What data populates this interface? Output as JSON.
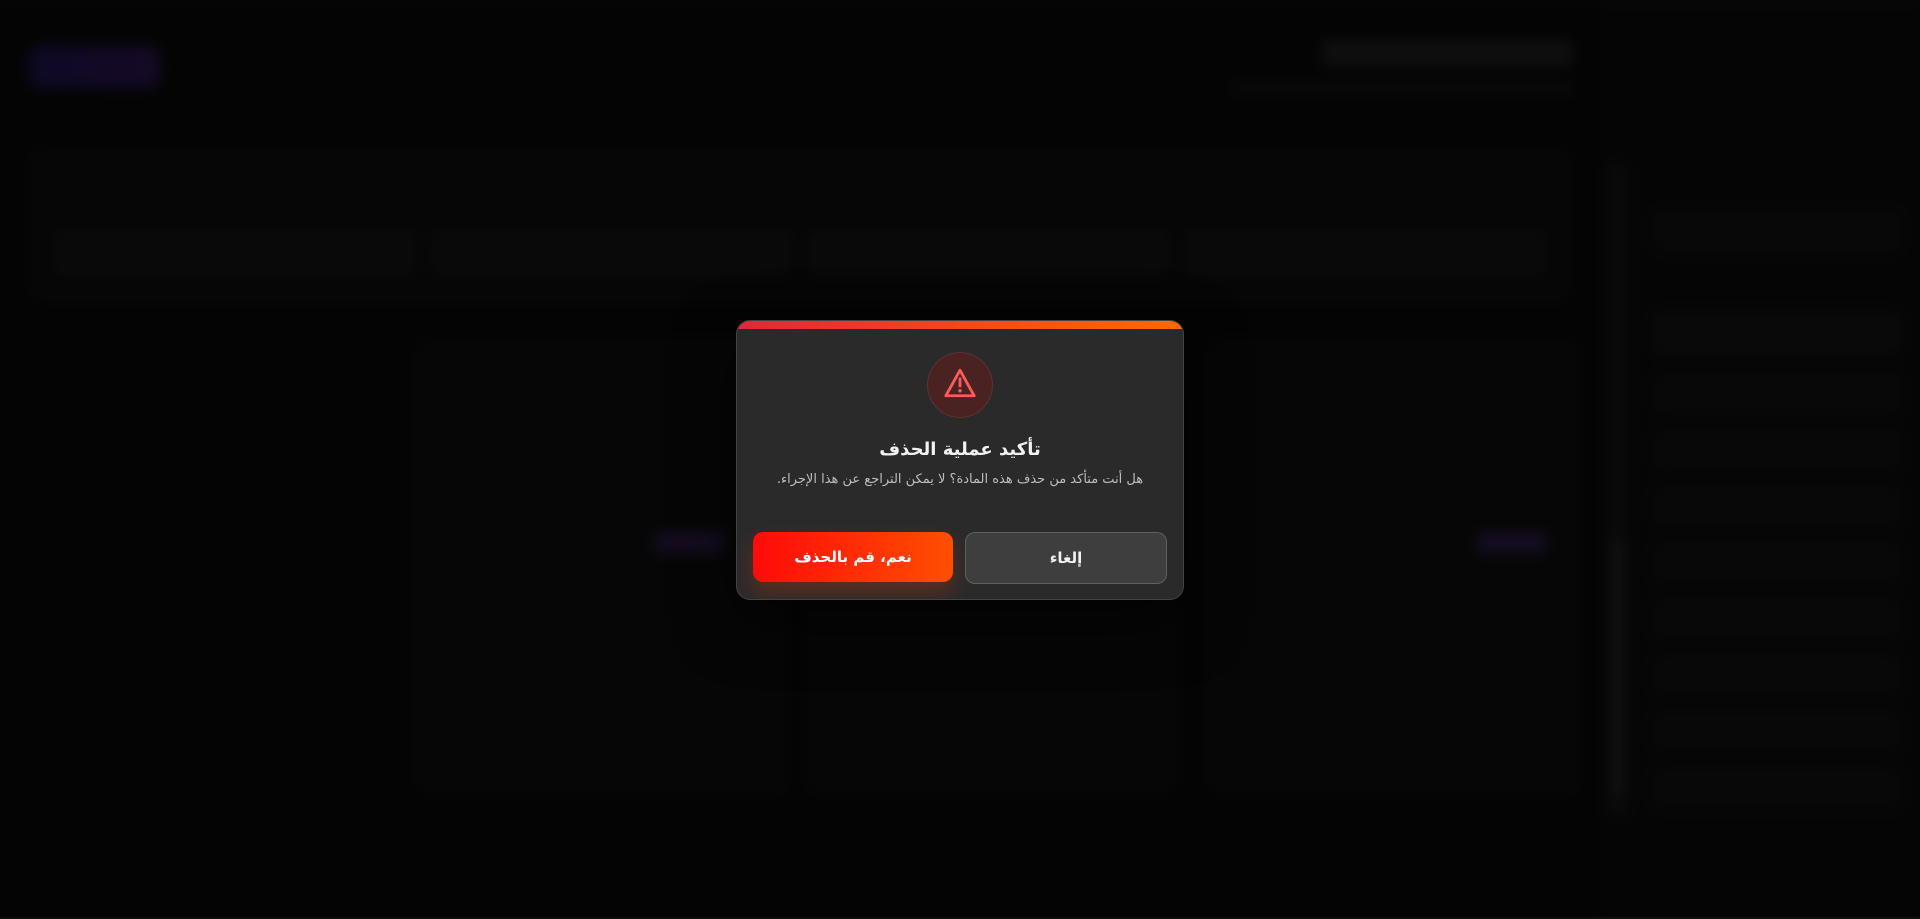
{
  "modal": {
    "title": "تأكيد عملية الحذف",
    "message": "هل أنت متأكد من حذف هذه المادة؟ لا يمكن التراجع عن هذا الإجراء.",
    "buttons": {
      "confirm_label": "نعم، قم بالحذف",
      "cancel_label": "إلغاء"
    },
    "icon": "warning-triangle-icon"
  },
  "colors": {
    "accent_gradient_start": "#e3263a",
    "accent_gradient_end": "#ff6a00",
    "danger_start": "#ff0a0a",
    "danger_end": "#ff4f00",
    "modal_bg": "#2a2a2a",
    "overlay": "rgba(0,0,0,0.70)"
  }
}
